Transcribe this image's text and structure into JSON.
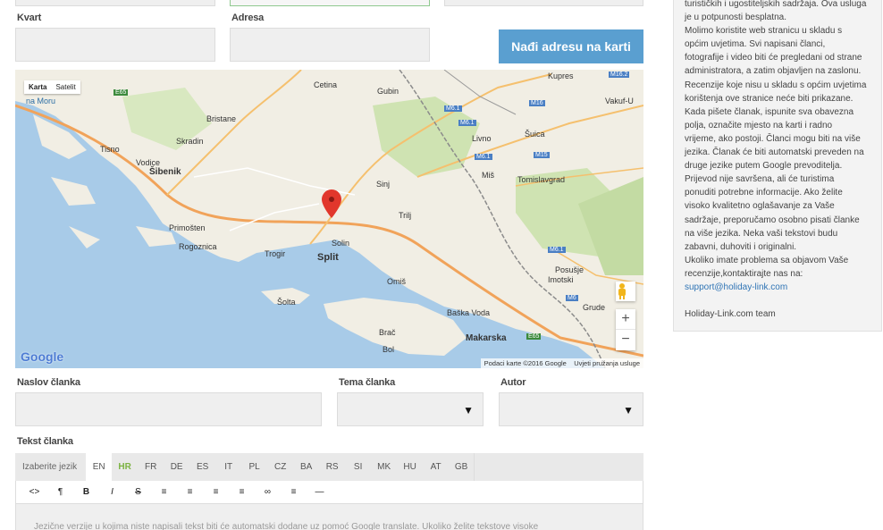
{
  "form": {
    "kvart_label": "Kvart",
    "adresa_label": "Adresa",
    "find_button": "Nađi adresu na karti",
    "naslov_label": "Naslov članka",
    "tema_label": "Tema članka",
    "autor_label": "Autor",
    "tekst_label": "Tekst članka"
  },
  "map": {
    "type_map": "Karta",
    "type_sat": "Satelit",
    "footer_data": "Podaci karte ©2016 Google",
    "footer_terms": "Uvjeti pružanja usluge",
    "logo": "Google",
    "zoom_in": "+",
    "zoom_out": "−",
    "places": {
      "na_moru": "na Moru",
      "bristane": "Bristane",
      "skradin": "Skradin",
      "tisno": "Tisno",
      "vodice": "Vodice",
      "sibenik": "Šibenik",
      "primosten": "Primošten",
      "rogoznica": "Rogoznica",
      "trogir": "Trogir",
      "solin": "Solin",
      "split": "Split",
      "solta": "Šolta",
      "brac": "Brač",
      "bol": "Bol",
      "cetina": "Cetina",
      "gubin": "Gubin",
      "sinj": "Sinj",
      "trilj": "Trilj",
      "omis": "Omiš",
      "livno": "Livno",
      "sujica": "Šuica",
      "kupres": "Kupres",
      "vakuf": "Vakuf-U",
      "tomislavgrad": "Tomislavgrad",
      "posusje": "Posušje",
      "imotski": "Imotski",
      "grude": "Grude",
      "baska": "Baška Voda",
      "makarska": "Makarska",
      "mis": "Miš"
    },
    "roads": {
      "e65a": "E65",
      "e65b": "E65",
      "m61a": "M6.1",
      "m61b": "M6.1",
      "m61c": "M6.1",
      "m61d": "M6.1",
      "m16": "M16",
      "m15": "M15",
      "m162": "M16.2",
      "m6": "M6"
    }
  },
  "editor": {
    "choose_language": "Izaberite jezik",
    "languages": [
      "EN",
      "HR",
      "FR",
      "DE",
      "ES",
      "IT",
      "PL",
      "CZ",
      "BA",
      "RS",
      "SI",
      "MK",
      "HU",
      "AT",
      "GB"
    ],
    "toolbar": [
      "<>",
      "¶",
      "B",
      "I",
      "S",
      "≡",
      "≡",
      "≡",
      "≡",
      "∞",
      "≡",
      "—"
    ],
    "hint": "Jezične verzije u kojima niste napisali tekst biti će automatski dodane uz pomoć Google translate. Ukoliko želite tekstove visoke"
  },
  "sidebar": {
    "lines": [
      "turističkih i ugostiteljskih sadržaja. Ova usluga",
      "je u potpunosti besplatna.",
      "Molimo koristite web stranicu u skladu s",
      "općim uvjetima. Svi napisani članci,",
      "fotografije i video biti će pregledani od strane",
      "administratora, a zatim objavljen na zaslonu.",
      "Recenzije koje nisu u skladu s općim uvjetima",
      "korištenja ove stranice neće biti prikazane.",
      "Kada pišete članak, ispunite sva obavezna",
      "polja, označite mjesto na karti i radno",
      "vrijeme, ako postoji. Članci mogu biti na više",
      "jezika. Članak će biti automatski preveden na",
      "druge jezike putem Google prevoditelja.",
      "Prijevod nije savršena, ali će turistima",
      "ponuditi potrebne informacije. Ako želite",
      "visoko kvalitetno oglašavanje za Vaše",
      "sadržaje, preporučamo osobno pisati članke",
      "na više jezika. Neka vaši tekstovi budu",
      "zabavni, duhoviti i originalni.",
      "Ukoliko imate problema sa objavom Vaše",
      "recenzije,kontaktirajte nas na:"
    ],
    "email": "support@holiday-link.com",
    "team": "Holiday-Link.com team"
  }
}
